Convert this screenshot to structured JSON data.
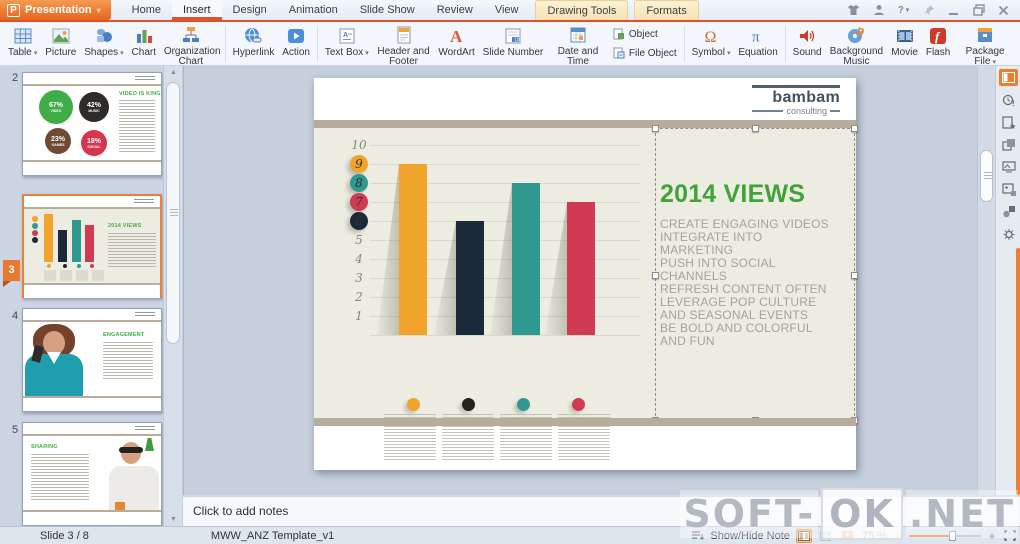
{
  "titlebar": {
    "app_button": "Presentation",
    "help_label": "?",
    "tabs": [
      {
        "label": "Home"
      },
      {
        "label": "Insert"
      },
      {
        "label": "Design"
      },
      {
        "label": "Animation"
      },
      {
        "label": "Slide Show"
      },
      {
        "label": "Review"
      },
      {
        "label": "View"
      },
      {
        "label": "Drawing Tools"
      },
      {
        "label": "Formats"
      }
    ]
  },
  "glyphs": {
    "dropdown": "▾",
    "scroll_up": "▲",
    "scroll_down": "▼"
  },
  "ribbon": {
    "buttons": [
      {
        "label": "Table"
      },
      {
        "label": "Picture"
      },
      {
        "label": "Shapes"
      },
      {
        "label": "Chart"
      },
      {
        "label": "Organization Chart"
      },
      {
        "label": "Hyperlink"
      },
      {
        "label": "Action"
      },
      {
        "label": "Text Box"
      },
      {
        "label": "Header and Footer"
      },
      {
        "label": "WordArt"
      },
      {
        "label": "Slide Number"
      },
      {
        "label": "Date and Time"
      },
      {
        "label": "Object"
      },
      {
        "label": "File Object"
      },
      {
        "label": "Symbol"
      },
      {
        "label": "Equation"
      },
      {
        "label": "Sound"
      },
      {
        "label": "Background Music"
      },
      {
        "label": "Movie"
      },
      {
        "label": "Flash"
      },
      {
        "label": "Package File"
      }
    ]
  },
  "slide_panel": {
    "slides": [
      {
        "number": "2",
        "title": "VIDEO IS KING",
        "stats": [
          {
            "pct": "67%",
            "label": "VIDEO",
            "color": "#3fae49"
          },
          {
            "pct": "42%",
            "label": "MUSIC",
            "color": "#2e2b28"
          },
          {
            "pct": "23%",
            "label": "GAMES",
            "color": "#6f4a35"
          },
          {
            "pct": "18%",
            "label": "SOCIAL",
            "color": "#d6354e"
          }
        ]
      },
      {
        "number": "3",
        "title": "2014 VIEWS",
        "selected": true
      },
      {
        "number": "4",
        "title": "ENGAGEMENT"
      },
      {
        "number": "5",
        "title": "SHARING"
      }
    ]
  },
  "slide": {
    "logo_name": "bambam",
    "logo_sub": "consulting",
    "heading": "2014 VIEWS",
    "body": "CREATE ENGAGING VIDEOS\nINTEGRATE INTO\nMARKETING\nPUSH INTO SOCIAL\nCHANNELS\nREFRESH CONTENT OFTEN\nLEVERAGE POP CULTURE\nAND SEASONAL EVENTS\nBE BOLD AND COLORFUL\nAND FUN"
  },
  "chart_data": {
    "type": "bar",
    "categories": [
      "bar-orange",
      "bar-navy",
      "bar-teal",
      "bar-crimson"
    ],
    "values": [
      9,
      6,
      8,
      7
    ],
    "colors": [
      "#f0a42c",
      "#1b2a3a",
      "#2f998f",
      "#d03a52"
    ],
    "title": "2014 VIEWS",
    "xlabel": "",
    "ylabel": "",
    "ylim": [
      0,
      10
    ],
    "yticks": [
      "10",
      "9",
      "8",
      "7",
      "6",
      "5",
      "4",
      "3",
      "2",
      "1"
    ],
    "highlighted_yticks": [
      {
        "tick": "9",
        "color": "#f0a42c"
      },
      {
        "tick": "8",
        "color": "#2f998f"
      },
      {
        "tick": "7",
        "color": "#d03a52"
      },
      {
        "tick": "6",
        "color": "#1b2a3a"
      }
    ],
    "grid": true,
    "legend_position": "below-bars",
    "legend_dots": [
      "#f0a42c",
      "#26221e",
      "#2f998f",
      "#d03a52"
    ]
  },
  "notes": {
    "placeholder": "Click to add notes"
  },
  "statusbar": {
    "slide_indicator": "Slide 3 / 8",
    "template_name": "MWW_ANZ Template_v1",
    "show_hide_note": "Show/Hide Note",
    "zoom_level": "75 %",
    "zoom_minus": "−",
    "zoom_plus": "+"
  },
  "watermark": {
    "part1": "SOFT-",
    "part2": "OK",
    "part3": ".NET"
  },
  "colors": {
    "accent_orange": "#e8702a",
    "tab_underline": "#e0512d",
    "green_title": "#3fa33a",
    "tan_bar": "#b9ac9d",
    "chart_bg": "#ecece1",
    "body_text_gray": "#a3a399"
  }
}
